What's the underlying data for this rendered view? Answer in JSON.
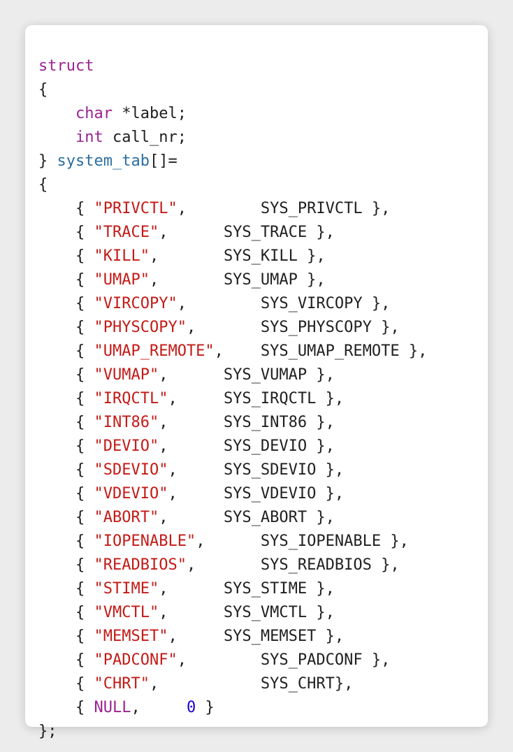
{
  "code": {
    "struct_kw": "struct",
    "open_brace": "{",
    "field1_type": "char",
    "field1_name": "*label;",
    "field2_type": "int",
    "field2_name": "call_nr;",
    "decl_close": "}",
    "decl_name": "system_tab",
    "decl_suffix": "[]=",
    "init_open": "{",
    "entries": [
      {
        "label": "\"PRIVCTL\"",
        "sep": ",        ",
        "value": "SYS_PRIVCTL",
        "end": " },"
      },
      {
        "label": "\"TRACE\"",
        "sep": ",      ",
        "value": "SYS_TRACE",
        "end": " },"
      },
      {
        "label": "\"KILL\"",
        "sep": ",       ",
        "value": "SYS_KILL",
        "end": " },"
      },
      {
        "label": "\"UMAP\"",
        "sep": ",       ",
        "value": "SYS_UMAP",
        "end": " },"
      },
      {
        "label": "\"VIRCOPY\"",
        "sep": ",        ",
        "value": "SYS_VIRCOPY",
        "end": " },"
      },
      {
        "label": "\"PHYSCOPY\"",
        "sep": ",       ",
        "value": "SYS_PHYSCOPY",
        "end": " },"
      },
      {
        "label": "\"UMAP_REMOTE\"",
        "sep": ",    ",
        "value": "SYS_UMAP_REMOTE",
        "end": " },"
      },
      {
        "label": "\"VUMAP\"",
        "sep": ",      ",
        "value": "SYS_VUMAP",
        "end": " },"
      },
      {
        "label": "\"IRQCTL\"",
        "sep": ",     ",
        "value": "SYS_IRQCTL",
        "end": " },"
      },
      {
        "label": "\"INT86\"",
        "sep": ",      ",
        "value": "SYS_INT86",
        "end": " },"
      },
      {
        "label": "\"DEVIO\"",
        "sep": ",      ",
        "value": "SYS_DEVIO",
        "end": " },"
      },
      {
        "label": "\"SDEVIO\"",
        "sep": ",     ",
        "value": "SYS_SDEVIO",
        "end": " },"
      },
      {
        "label": "\"VDEVIO\"",
        "sep": ",     ",
        "value": "SYS_VDEVIO",
        "end": " },"
      },
      {
        "label": "\"ABORT\"",
        "sep": ",      ",
        "value": "SYS_ABORT",
        "end": " },"
      },
      {
        "label": "\"IOPENABLE\"",
        "sep": ",      ",
        "value": "SYS_IOPENABLE",
        "end": " },"
      },
      {
        "label": "\"READBIOS\"",
        "sep": ",       ",
        "value": "SYS_READBIOS",
        "end": " },"
      },
      {
        "label": "\"STIME\"",
        "sep": ",      ",
        "value": "SYS_STIME",
        "end": " },"
      },
      {
        "label": "\"VMCTL\"",
        "sep": ",      ",
        "value": "SYS_VMCTL",
        "end": " },"
      },
      {
        "label": "\"MEMSET\"",
        "sep": ",     ",
        "value": "SYS_MEMSET",
        "end": " },"
      },
      {
        "label": "\"PADCONF\"",
        "sep": ",        ",
        "value": "SYS_PADCONF",
        "end": " },"
      },
      {
        "label": "\"CHRT\"",
        "sep": ",           ",
        "value": "SYS_CHRT",
        "end": "},"
      }
    ],
    "null_entry": {
      "open": "{ ",
      "label": "NULL",
      "sep": ",     ",
      "value": "0",
      "end": " }"
    },
    "final_close": "};"
  },
  "colors": {
    "keyword": "#9b2393",
    "identifier": "#2a6ea3",
    "string": "#c41a16",
    "number": "#1c00cf",
    "text": "#1f1f1f"
  }
}
